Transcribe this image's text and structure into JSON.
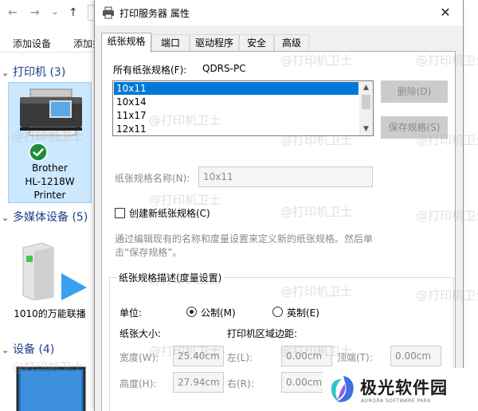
{
  "explorer": {
    "nav": {
      "back": "←",
      "forward": "→",
      "dropdown": "⌄",
      "up": "↑"
    },
    "toolbar": {
      "add_device": "添加设备",
      "add_printer_partial": "添加打"
    },
    "groups": {
      "printers": "打印机 (3)",
      "multimedia": "多媒体设备 (5)",
      "devices": "设备 (4)"
    },
    "printer_tile": {
      "line1": "Brother",
      "line2": "HL-1218W",
      "line3": "Printer"
    },
    "media_device": {
      "label": "1010的万能联播"
    }
  },
  "dialog": {
    "title": "打印服务器 属性",
    "close_glyph": "✕",
    "tabs": [
      "纸张规格",
      "端口",
      "驱动程序",
      "安全",
      "高级"
    ],
    "forms_on_label": "所有纸张规格(F):",
    "forms_on_value": "QDRS-PC",
    "forms_list": [
      "10x11",
      "10x14",
      "11x17",
      "12x11"
    ],
    "delete_button": "删除(D)",
    "save_button": "保存规格(S)",
    "form_name_label": "纸张规格名称(N):",
    "form_name_value": "10x11",
    "create_new_label": "创建新纸张规格(C)",
    "description_line1": "通过编辑现有的名称和度量设置来定义新的纸张规格。然后单",
    "description_line2": "击“保存规格”。",
    "groupbox_title": "纸张规格描述(度量设置)",
    "units_label": "单位:",
    "metric_label": "公制(M)",
    "english_label": "英制(E)",
    "paper_size_label": "纸张大小:",
    "margins_label": "打印机区域边距:",
    "width_label": "宽度(W):",
    "width_value": "25.40cm",
    "height_label": "高度(H):",
    "height_value": "27.94cm",
    "left_label": "左(L):",
    "left_value": "0.00cm",
    "right_label": "右(R):",
    "right_value": "0.00cm",
    "top_label": "顶端(T):",
    "top_value": "0.00cm"
  },
  "watermark": "@打印机卫士",
  "logo": {
    "name": "极光软件园",
    "sub": "AURORA SOFTWARE PARK"
  },
  "colors": {
    "selection": "#0078d7",
    "check_green": "#1e8e3e",
    "header_blue": "#1e3f87"
  }
}
